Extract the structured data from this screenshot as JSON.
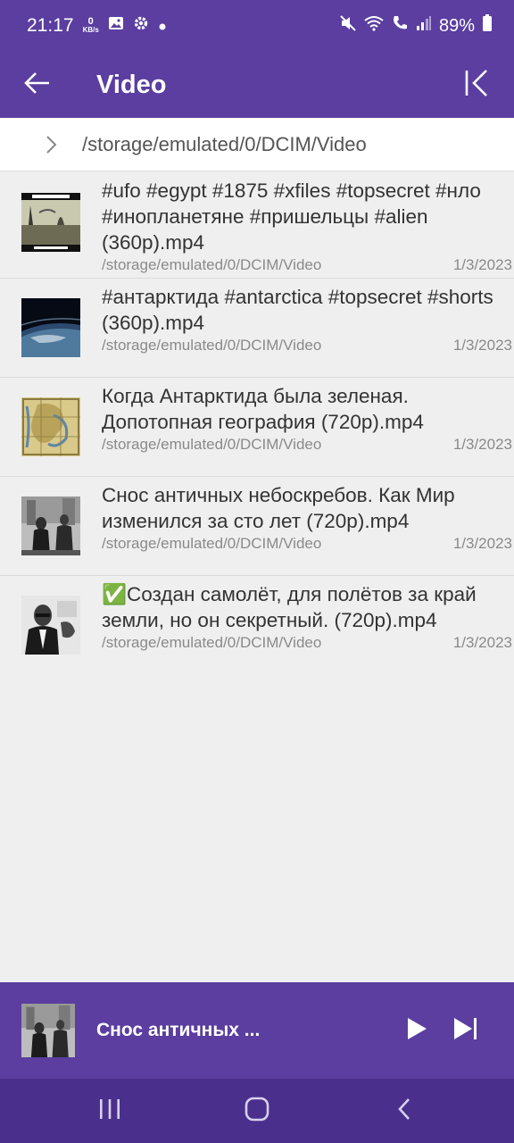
{
  "status_bar": {
    "time": "21:17",
    "net_speed_value": "0",
    "net_speed_unit": "KB/s",
    "battery": "89%",
    "icons": [
      "gallery-icon",
      "settings-icon",
      "dot-icon",
      "mute-icon",
      "wifi-icon",
      "call-icon",
      "signal-icon",
      "battery-icon"
    ]
  },
  "app_bar": {
    "title": "Video",
    "back_icon": "arrow-left-icon",
    "first_icon": "skip-to-start-icon"
  },
  "path_bar": {
    "path": "/storage/emulated/0/DCIM/Video"
  },
  "files": [
    {
      "name": "#ufo #egypt #1875 #xfiles #topsecret #нло #инопланетяне #пришельцы #alien (360p).mp4",
      "path": "/storage/emulated/0/DCIM/Video",
      "date": "1/3/2023"
    },
    {
      "name": "#антарктида #antarctica #topsecret #shorts (360p).mp4",
      "path": "/storage/emulated/0/DCIM/Video",
      "date": "1/3/2023"
    },
    {
      "name": "Когда Антарктида была зеленая. Допотопная география (720p).mp4",
      "path": "/storage/emulated/0/DCIM/Video",
      "date": "1/3/2023"
    },
    {
      "name": "Снос античных небоскребов. Как Мир изменился за сто лет (720p).mp4",
      "path": "/storage/emulated/0/DCIM/Video",
      "date": "1/3/2023"
    },
    {
      "name": "✅Создан самолёт, для полётов за край земли, но он секретный. (720p).mp4",
      "path": "/storage/emulated/0/DCIM/Video",
      "date": "1/3/2023"
    }
  ],
  "mini_player": {
    "title": "Снос античных ...",
    "play_icon": "play-icon",
    "next_icon": "skip-next-icon"
  },
  "nav_bar": {
    "icons": [
      "recent-apps-icon",
      "home-icon",
      "back-icon"
    ]
  },
  "colors": {
    "accent": "#5b3ea0",
    "nav_bar": "#4a2f8c",
    "background": "#efefef"
  }
}
